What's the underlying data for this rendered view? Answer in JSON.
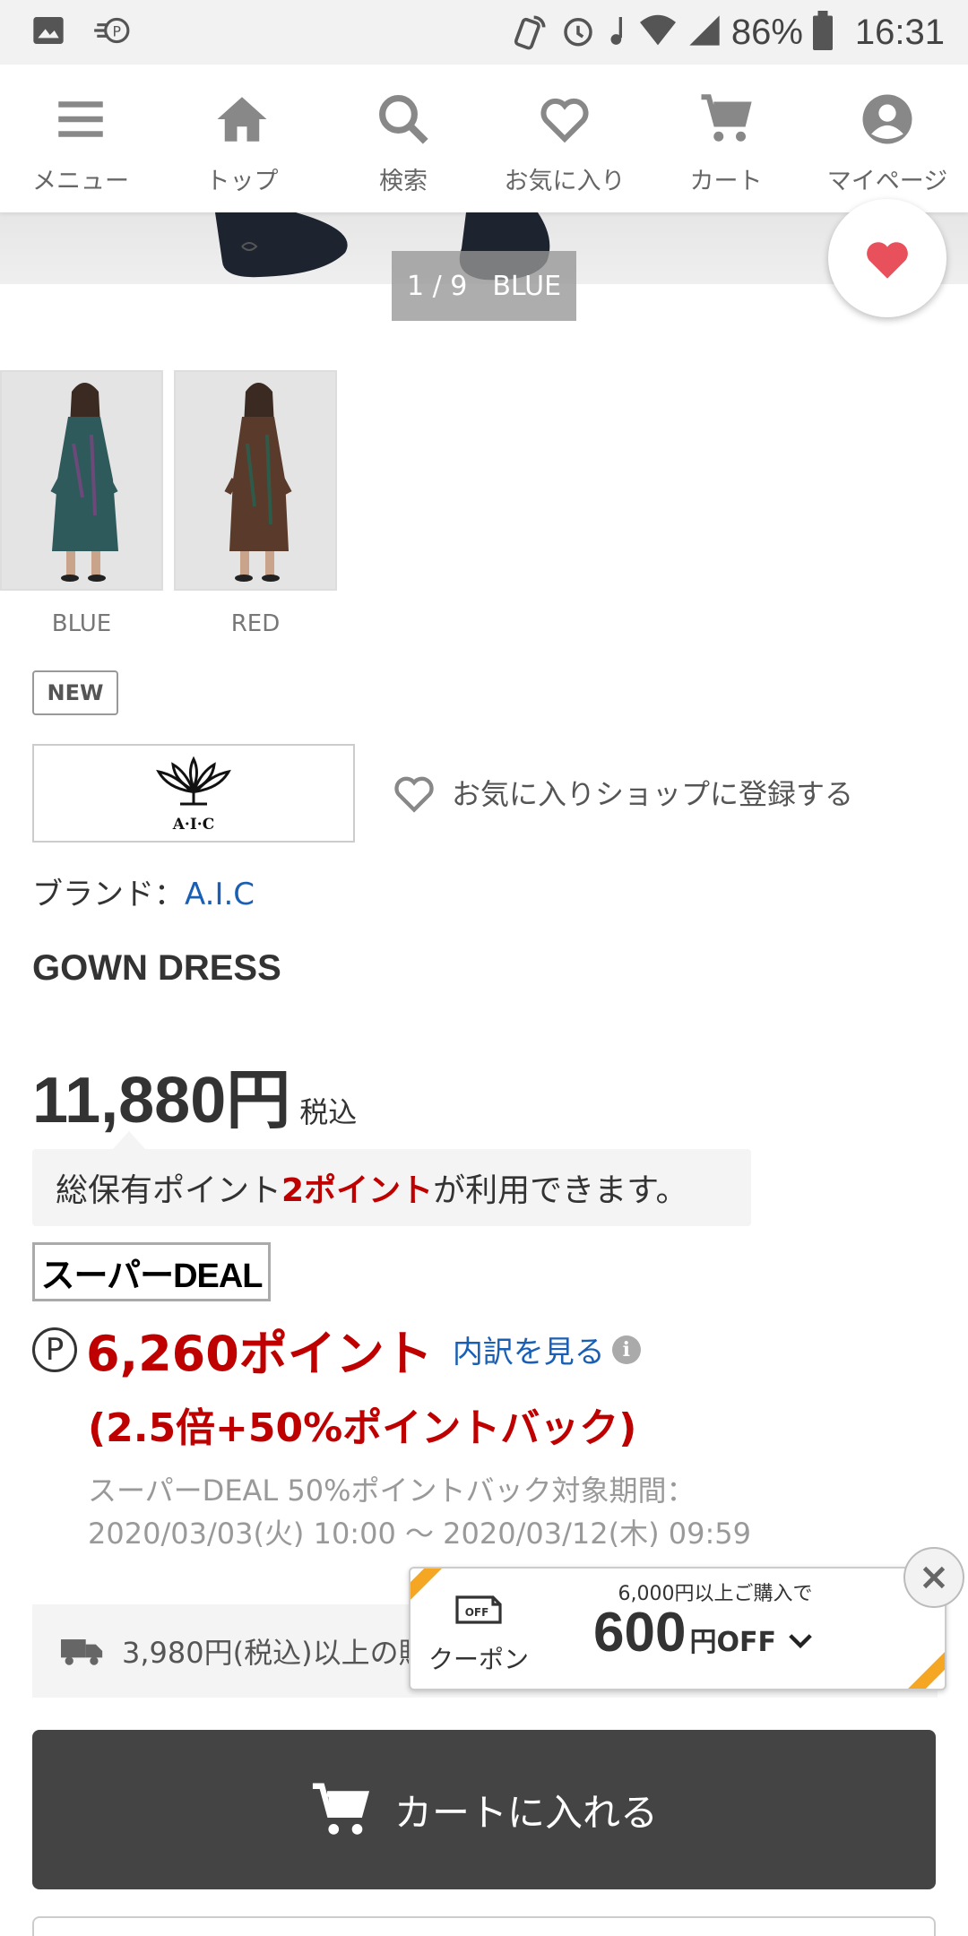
{
  "status_bar": {
    "battery": "86%",
    "time": "16:31"
  },
  "nav": {
    "items": [
      {
        "label": "メニュー",
        "icon": "menu-icon"
      },
      {
        "label": "トップ",
        "icon": "home-icon"
      },
      {
        "label": "検索",
        "icon": "search-icon"
      },
      {
        "label": "お気に入り",
        "icon": "heart-icon"
      },
      {
        "label": "カート",
        "icon": "cart-icon"
      },
      {
        "label": "マイページ",
        "icon": "account-icon"
      }
    ]
  },
  "gallery": {
    "pager": "1 / 9",
    "color": "BLUE"
  },
  "thumbnails": [
    {
      "label": "BLUE",
      "dress_color": "#2f5a5a"
    },
    {
      "label": "RED",
      "dress_color": "#5a3a2a"
    }
  ],
  "badge": {
    "new": "NEW"
  },
  "brand_logo": {
    "text": "A·I·C"
  },
  "shop": {
    "favorite_label": "お気に入りショップに登録する"
  },
  "brand": {
    "prefix": "ブランド：",
    "name": "A.I.C"
  },
  "product": {
    "title": "GOWN DRESS"
  },
  "price": {
    "amount": "11,880円",
    "tax": "税込"
  },
  "points": {
    "pre": "総保有ポイント",
    "value": "2ポイント",
    "post": "が利用できます。"
  },
  "super_deal": {
    "badge": "スーパーDEAL",
    "p_symbol": "P",
    "points": "6,260ポイント",
    "breakdown": "内訳を見る",
    "multiplier": "(2.5倍+50%ポイントバック)",
    "period_label": "スーパーDEAL 50%ポイントバック対象期間：",
    "period": "2020/03/03(火) 10:00 〜 2020/03/12(木) 09:59"
  },
  "shipping": {
    "text": "3,980円(税込)以上の購"
  },
  "coupon": {
    "icon_text": "OFF",
    "label": "クーポン",
    "condition": "6,000円以上ご購入で",
    "amount": "600",
    "unit": "円OFF"
  },
  "cart": {
    "label": "カートに入れる"
  },
  "colors": {
    "accent_red": "#bf0000",
    "link_blue": "#1a5fb4",
    "button_dark": "#444444",
    "coupon_stripe": "#f5a623"
  }
}
